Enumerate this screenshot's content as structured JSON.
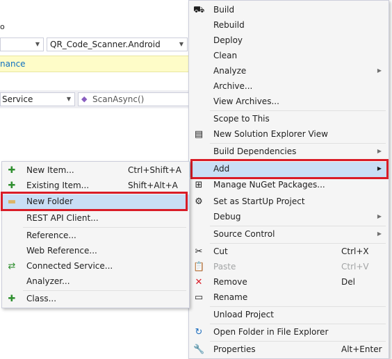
{
  "ide": {
    "cutoff_text": "o",
    "project_combo": "QR_Code_Scanner.Android",
    "info_bar_text": "nance",
    "nav_class_combo": "Service",
    "nav_member_combo": "ScanAsync()"
  },
  "context_menu": {
    "items": [
      {
        "label": "Build",
        "icon": "build-icon"
      },
      {
        "label": "Rebuild"
      },
      {
        "label": "Deploy"
      },
      {
        "label": "Clean"
      },
      {
        "label": "Analyze",
        "submenu": true
      },
      {
        "label": "Archive..."
      },
      {
        "label": "View Archives..."
      },
      {
        "label": "Scope to This"
      },
      {
        "label": "New Solution Explorer View",
        "icon": "new-solution-explorer-view-icon"
      },
      {
        "label": "Build Dependencies",
        "submenu": true
      },
      {
        "label": "Add",
        "submenu": true,
        "highlighted": true
      },
      {
        "label": "Manage NuGet Packages...",
        "icon": "nuget-icon"
      },
      {
        "label": "Set as StartUp Project",
        "icon": "gear-icon"
      },
      {
        "label": "Debug",
        "submenu": true
      },
      {
        "label": "Source Control",
        "submenu": true
      },
      {
        "label": "Cut",
        "shortcut": "Ctrl+X",
        "icon": "scissors-icon"
      },
      {
        "label": "Paste",
        "shortcut": "Ctrl+V",
        "icon": "paste-icon",
        "disabled": true
      },
      {
        "label": "Remove",
        "shortcut": "Del",
        "icon": "remove-x-icon"
      },
      {
        "label": "Rename",
        "icon": "rename-icon"
      },
      {
        "label": "Unload Project"
      },
      {
        "label": "Open Folder in File Explorer",
        "icon": "refresh-arrow-icon"
      },
      {
        "label": "Properties",
        "shortcut": "Alt+Enter",
        "icon": "wrench-icon"
      }
    ]
  },
  "add_submenu": {
    "items": [
      {
        "label": "New Item...",
        "shortcut": "Ctrl+Shift+A",
        "icon": "new-item-icon"
      },
      {
        "label": "Existing Item...",
        "shortcut": "Shift+Alt+A",
        "icon": "existing-item-icon"
      },
      {
        "label": "New Folder",
        "icon": "new-folder-icon",
        "highlighted": true
      },
      {
        "label": "REST API Client..."
      },
      {
        "label": "Reference..."
      },
      {
        "label": "Web Reference..."
      },
      {
        "label": "Connected Service...",
        "icon": "connected-service-icon"
      },
      {
        "label": "Analyzer..."
      },
      {
        "label": "Class...",
        "icon": "class-icon"
      }
    ]
  },
  "colors": {
    "highlight": "#c9def5",
    "annotation_red": "#d91c27",
    "menu_background": "#f5f5f5"
  }
}
